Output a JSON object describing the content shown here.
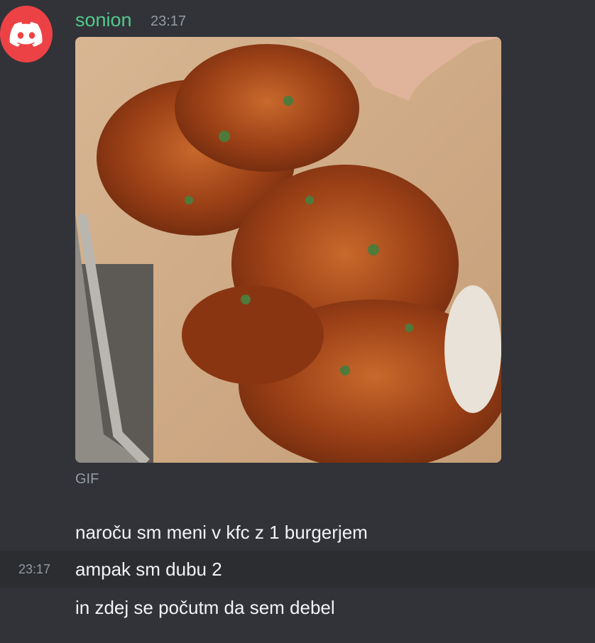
{
  "message": {
    "username": "sonion",
    "timestamp": "23:17",
    "gif_label": "GIF",
    "lines": [
      "naroču sm meni v kfc z 1 burgerjem",
      "ampak sm dubu 2",
      "in zdej se počutm da sem debel"
    ],
    "hover_timestamp": "23:17"
  },
  "colors": {
    "username": "#52c98c",
    "background": "#313338",
    "avatar": "#ed4245"
  }
}
